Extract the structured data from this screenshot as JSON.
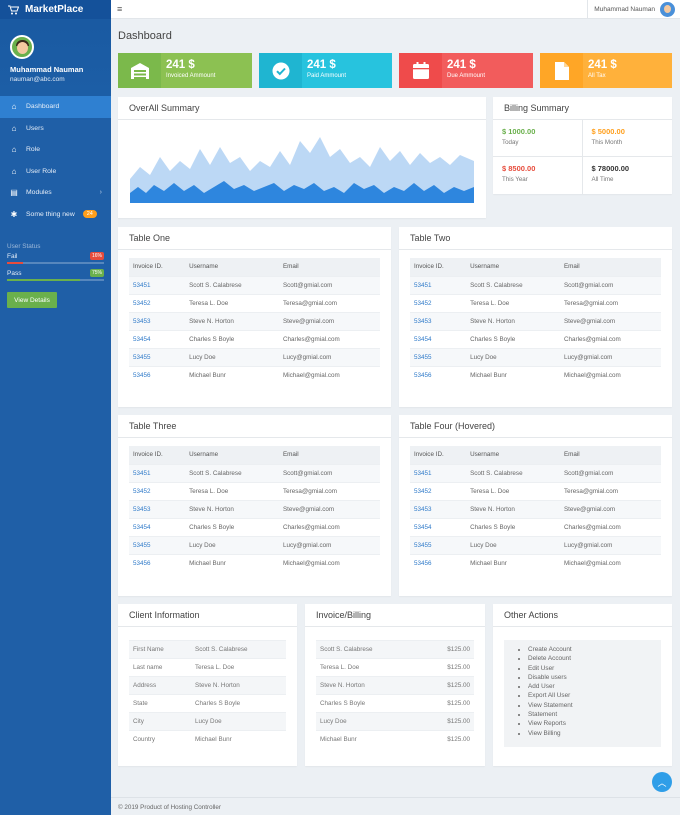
{
  "brand": {
    "name": "MarketPlace"
  },
  "profile": {
    "name": "Muhammad Nauman",
    "email": "nauman@abc.com"
  },
  "nav": {
    "items": [
      {
        "label": "Dashboard"
      },
      {
        "label": "Users"
      },
      {
        "label": "Role"
      },
      {
        "label": "User Role"
      },
      {
        "label": "Modules"
      },
      {
        "label": "Some thing new",
        "badge": "24"
      }
    ]
  },
  "user_status": {
    "title": "User Status",
    "fail": {
      "label": "Fail",
      "badge": "16%",
      "fraction": 0.16,
      "color": "#e74c3c"
    },
    "pass": {
      "label": "Pass",
      "badge": "75%",
      "fraction": 0.75,
      "color": "#6ab04c"
    },
    "button": "View Details"
  },
  "topbar": {
    "user_name": "Muhammad Nauman"
  },
  "page_title": "Dashboard",
  "stats": [
    {
      "value": "241 $",
      "label": "Invoiced Ammount",
      "color": "#7bb94b",
      "icon": "garage-icon"
    },
    {
      "value": "241 $",
      "label": "Paid Ammount",
      "color": "#1fb5d1",
      "icon": "check-circle-icon"
    },
    {
      "value": "241 $",
      "label": "Due Ammount",
      "color": "#ef4b4b",
      "icon": "calendar-icon"
    },
    {
      "value": "241 $",
      "label": "All Tax",
      "color": "#ffa626",
      "icon": "file-icon"
    }
  ],
  "overall_summary": {
    "title": "OverAll Summary"
  },
  "billing_summary": {
    "title": "Billing Summary",
    "cells": [
      {
        "value": "$ 1000.00",
        "label": "Today",
        "color": "#6ab04c"
      },
      {
        "value": "$ 5000.00",
        "label": "This Month",
        "color": "#ff9f1c"
      },
      {
        "value": "$ 8500.00",
        "label": "This Year",
        "color": "#e74c3c"
      },
      {
        "value": "$ 78000.00",
        "label": "All Time",
        "color": "#333333"
      }
    ]
  },
  "table_headers": [
    "Invoice ID.",
    "Username",
    "Email"
  ],
  "tables": [
    {
      "title": "Table One",
      "rows": [
        [
          "53451",
          "Scott S. Calabrese",
          "Scott@gmial.com"
        ],
        [
          "53452",
          "Teresa L. Doe",
          "Teresa@gmial.com"
        ],
        [
          "53453",
          "Steve N. Horton",
          "Steve@gmial.com"
        ],
        [
          "53454",
          "Charles S Boyle",
          "Charles@gmial.com"
        ],
        [
          "53455",
          "Lucy Doe",
          "Lucy@gmial.com"
        ],
        [
          "53456",
          "Michael Bunr",
          "Michael@gmial.com"
        ]
      ]
    },
    {
      "title": "Table Two",
      "rows": [
        [
          "53451",
          "Scott S. Calabrese",
          "Scott@gmial.com"
        ],
        [
          "53452",
          "Teresa L. Doe",
          "Teresa@gmial.com"
        ],
        [
          "53453",
          "Steve N. Horton",
          "Steve@gmial.com"
        ],
        [
          "53454",
          "Charles S Boyle",
          "Charles@gmial.com"
        ],
        [
          "53455",
          "Lucy Doe",
          "Lucy@gmial.com"
        ],
        [
          "53456",
          "Michael Bunr",
          "Michael@gmial.com"
        ]
      ]
    },
    {
      "title": "Table Three",
      "rows": [
        [
          "53451",
          "Scott S. Calabrese",
          "Scott@gmial.com"
        ],
        [
          "53452",
          "Teresa L. Doe",
          "Teresa@gmial.com"
        ],
        [
          "53453",
          "Steve N. Horton",
          "Steve@gmial.com"
        ],
        [
          "53454",
          "Charles S Boyle",
          "Charles@gmial.com"
        ],
        [
          "53455",
          "Lucy Doe",
          "Lucy@gmial.com"
        ],
        [
          "53456",
          "Michael Bunr",
          "Michael@gmial.com"
        ]
      ]
    },
    {
      "title": "Table Four (Hovered)",
      "rows": [
        [
          "53451",
          "Scott S. Calabrese",
          "Scott@gmial.com"
        ],
        [
          "53452",
          "Teresa L. Doe",
          "Teresa@gmial.com"
        ],
        [
          "53453",
          "Steve N. Horton",
          "Steve@gmial.com"
        ],
        [
          "53454",
          "Charles S Boyle",
          "Charles@gmial.com"
        ],
        [
          "53455",
          "Lucy Doe",
          "Lucy@gmial.com"
        ],
        [
          "53456",
          "Michael Bunr",
          "Michael@gmial.com"
        ]
      ]
    }
  ],
  "client_info": {
    "title": "Client Information",
    "rows": [
      [
        "First Name",
        "Scott S. Calabrese"
      ],
      [
        "Last name",
        "Teresa L. Doe"
      ],
      [
        "Address",
        "Steve N. Horton"
      ],
      [
        "State",
        "Charles S Boyle"
      ],
      [
        "City",
        "Lucy Doe"
      ],
      [
        "Country",
        "Michael Bunr"
      ]
    ]
  },
  "invoice_billing": {
    "title": "Invoice/Billing",
    "rows": [
      [
        "Scott S. Calabrese",
        "$125.00"
      ],
      [
        "Teresa L. Doe",
        "$125.00"
      ],
      [
        "Steve N. Horton",
        "$125.00"
      ],
      [
        "Charles S Boyle",
        "$125.00"
      ],
      [
        "Lucy Doe",
        "$125.00"
      ],
      [
        "Michael Bunr",
        "$125.00"
      ]
    ]
  },
  "other_actions": {
    "title": "Other Actions",
    "items": [
      "Create Account",
      "Delete Account",
      "Edit User",
      "Disable users",
      "Add User",
      "Export All User",
      "View Statement",
      "Statement",
      "View Reports",
      "View Billing"
    ]
  },
  "footer": {
    "text": "© 2019 Product of Hosting Controller"
  }
}
